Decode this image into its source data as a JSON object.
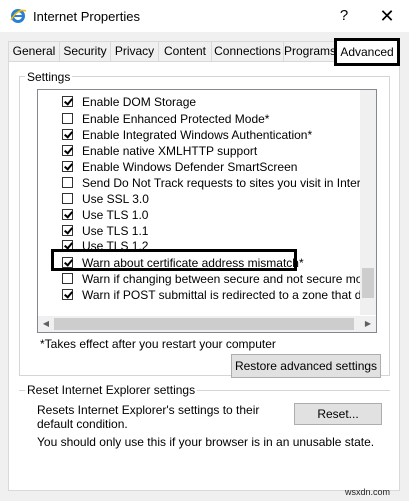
{
  "window": {
    "title": "Internet Properties",
    "help_label": "?",
    "close_label": "✕"
  },
  "tabs": [
    {
      "label": "General"
    },
    {
      "label": "Security"
    },
    {
      "label": "Privacy"
    },
    {
      "label": "Content"
    },
    {
      "label": "Connections"
    },
    {
      "label": "Programs"
    },
    {
      "label": "Advanced"
    }
  ],
  "settings": {
    "group_label": "Settings",
    "items": [
      {
        "label": "Enable DOM Storage",
        "checked": true
      },
      {
        "label": "Enable Enhanced Protected Mode*",
        "checked": false
      },
      {
        "label": "Enable Integrated Windows Authentication*",
        "checked": true
      },
      {
        "label": "Enable native XMLHTTP support",
        "checked": true
      },
      {
        "label": "Enable Windows Defender SmartScreen",
        "checked": true
      },
      {
        "label": "Send Do Not Track requests to sites you visit in Internet E",
        "checked": false
      },
      {
        "label": "Use SSL 3.0",
        "checked": false
      },
      {
        "label": "Use TLS 1.0",
        "checked": true
      },
      {
        "label": "Use TLS 1.1",
        "checked": true
      },
      {
        "label": "Use TLS 1.2",
        "checked": true
      },
      {
        "label": "Warn about certificate address mismatch*",
        "checked": true
      },
      {
        "label": "Warn if changing between secure and not secure mode",
        "checked": false
      },
      {
        "label": "Warn if POST submittal is redirected to a zone that does n",
        "checked": true
      }
    ],
    "footnote": "*Takes effect after you restart your computer",
    "restore_button": "Restore advanced settings"
  },
  "reset": {
    "group_label": "Reset Internet Explorer settings",
    "description": "Resets Internet Explorer's settings to their default condition.",
    "button": "Reset...",
    "warning": "You should only use this if your browser is in an unusable state."
  },
  "watermark": "wsxdn.com"
}
